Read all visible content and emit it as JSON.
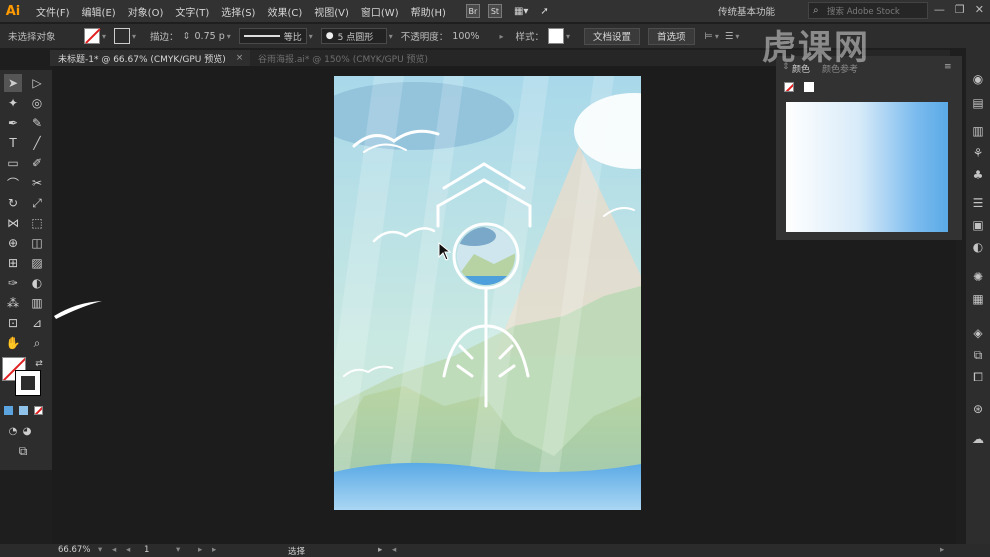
{
  "app": {
    "logo": "Ai",
    "menu": [
      "文件(F)",
      "编辑(E)",
      "对象(O)",
      "文字(T)",
      "选择(S)",
      "效果(C)",
      "视图(V)",
      "窗口(W)",
      "帮助(H)"
    ],
    "badges": [
      "Br",
      "St"
    ],
    "workspace": "传统基本功能",
    "search_placeholder": "搜索 Adobe Stock"
  },
  "control_bar": {
    "selection": "未选择对象",
    "stroke_label": "描边：",
    "stroke_value": "0.75 p",
    "stroke_profile": "等比",
    "brush": "5 点圆形",
    "opacity_label": "不透明度：",
    "opacity_value": "100%",
    "style_label": "样式：",
    "doc_setup_btn": "文档设置",
    "preferences_btn": "首选项"
  },
  "tabs": [
    {
      "label": "未标题-1* @ 66.67% (CMYK/GPU 预览)",
      "close": "×"
    },
    {
      "label": "谷雨海报.ai* @ 150% (CMYK/GPU 预览)"
    }
  ],
  "panel": {
    "tab_swatches": "颜色",
    "tab_guide": "颜色参考"
  },
  "status": {
    "zoom": "66.67%",
    "artboard_num": "1",
    "tool_name": "选择"
  },
  "watermark": "虎课网",
  "colors": {
    "accent_orange": "#ff9a00",
    "sky": "#a8d8ea",
    "sea": "#5aaae6",
    "mountain": "#a9c59a",
    "panel_bg": "#323232",
    "canvas_bg": "#1c1c1c"
  }
}
